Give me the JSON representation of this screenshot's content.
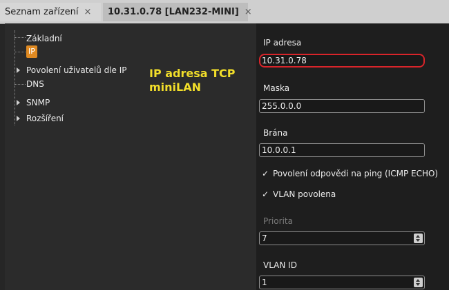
{
  "tabs": [
    {
      "label": "Seznam zařízení",
      "close": "×"
    },
    {
      "label": "10.31.0.78 [LAN232-MINI]",
      "close": "×"
    }
  ],
  "tree": {
    "items": [
      "Základní",
      "IP",
      "Povolení uživatelů dle IP",
      "DNS",
      "SNMP",
      "Rozšíření"
    ],
    "ip_icon": "IP"
  },
  "annotation": [
    "IP adresa TCP",
    "miniLAN"
  ],
  "form": {
    "ip_label": "IP adresa",
    "ip_value": "10.31.0.78",
    "mask_label": "Maska",
    "mask_value": "255.0.0.0",
    "gateway_label": "Brána",
    "gateway_value": "10.0.0.1",
    "ping_label": "Povolení odpovědi na ping (ICMP ECHO)",
    "ping_checked": "✓",
    "vlan_label": "VLAN povolena",
    "vlan_checked": "✓",
    "priority_label": "Priorita",
    "priority_value": "7",
    "vlan_id_label": "VLAN ID",
    "vlan_id_value": "1"
  },
  "colors": {
    "highlight": "#d9242a",
    "annotation": "#f2de2a",
    "ip_icon": "#e08a22"
  }
}
